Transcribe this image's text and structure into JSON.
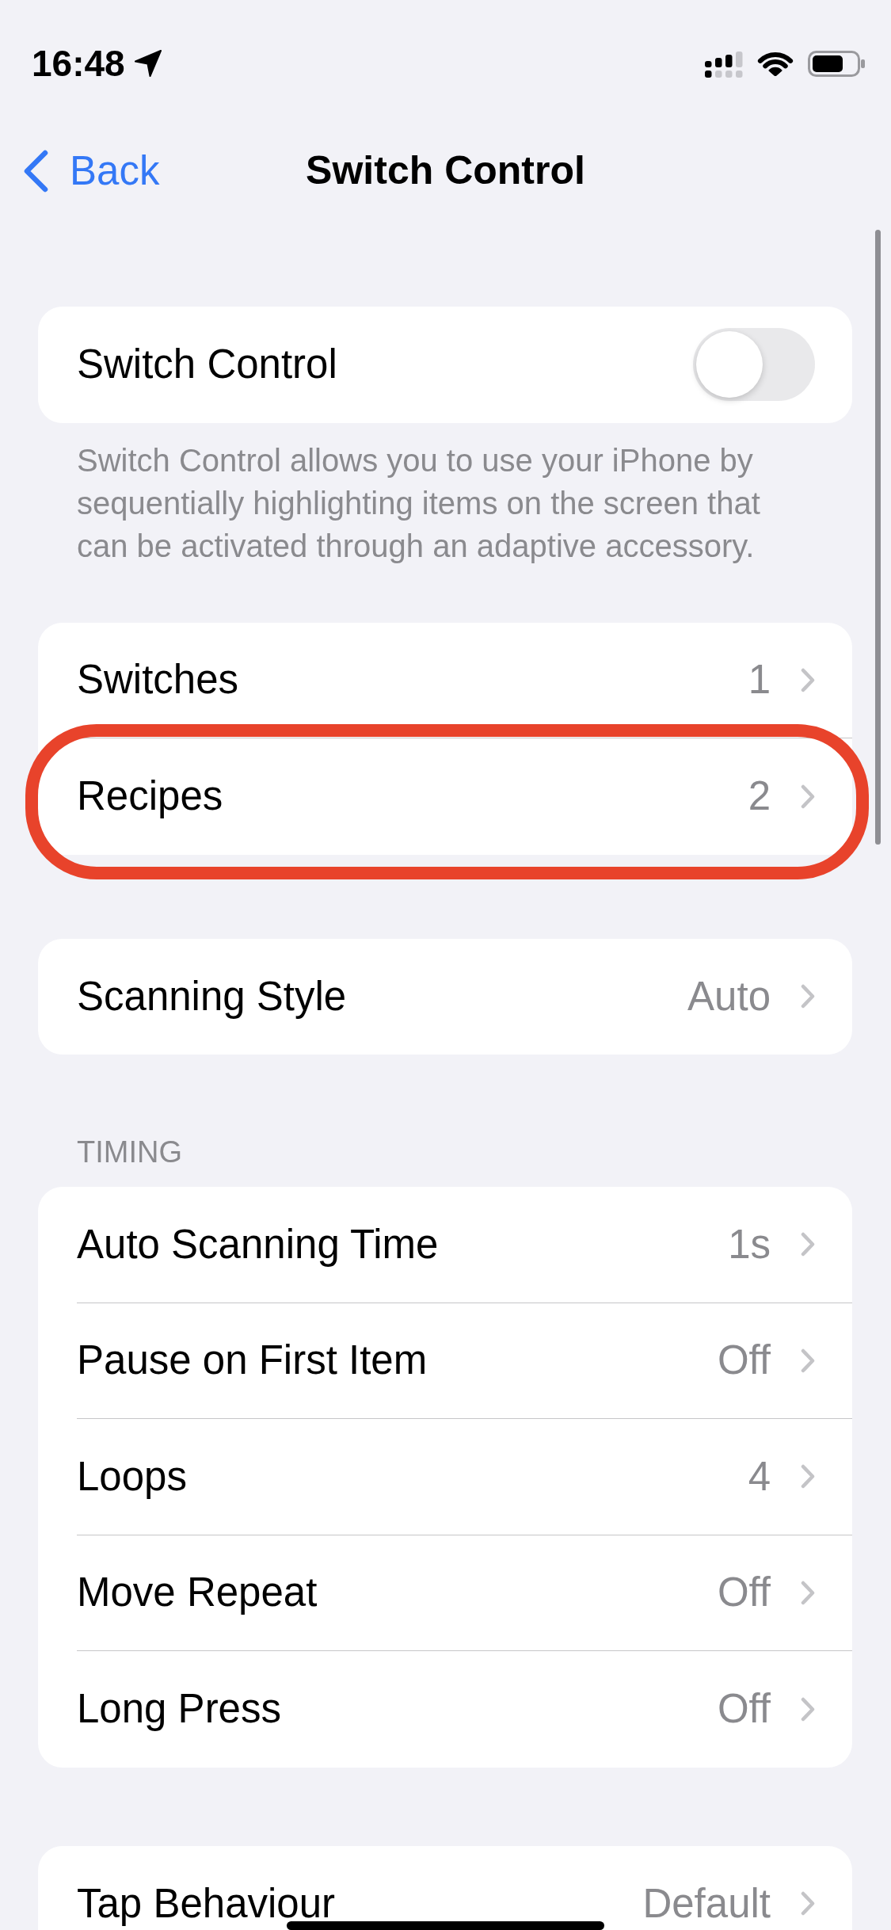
{
  "status_bar": {
    "time": "16:48"
  },
  "nav": {
    "back": "Back",
    "title": "Switch Control"
  },
  "sections": [
    {
      "items": [
        {
          "kind": "toggle",
          "label": "Switch Control",
          "on": false,
          "highlighted": false
        }
      ],
      "footer": "Switch Control allows you to use your iPhone by sequentially highlighting items on the screen that can be activated through an adaptive accessory."
    },
    {
      "items": [
        {
          "kind": "link",
          "label": "Switches",
          "value": "1",
          "highlighted": false
        },
        {
          "kind": "link",
          "label": "Recipes",
          "value": "2",
          "highlighted": true
        }
      ]
    },
    {
      "items": [
        {
          "kind": "link",
          "label": "Scanning Style",
          "value": "Auto",
          "highlighted": false
        }
      ]
    },
    {
      "header": "TIMING",
      "items": [
        {
          "kind": "link",
          "label": "Auto Scanning Time",
          "value": "1s",
          "highlighted": false
        },
        {
          "kind": "link",
          "label": "Pause on First Item",
          "value": "Off",
          "highlighted": false
        },
        {
          "kind": "link",
          "label": "Loops",
          "value": "4",
          "highlighted": false
        },
        {
          "kind": "link",
          "label": "Move Repeat",
          "value": "Off",
          "highlighted": false
        },
        {
          "kind": "link",
          "label": "Long Press",
          "value": "Off",
          "highlighted": false
        }
      ]
    },
    {
      "items": [
        {
          "kind": "link",
          "label": "Tap Behaviour",
          "value": "Default",
          "highlighted": false
        }
      ]
    }
  ]
}
